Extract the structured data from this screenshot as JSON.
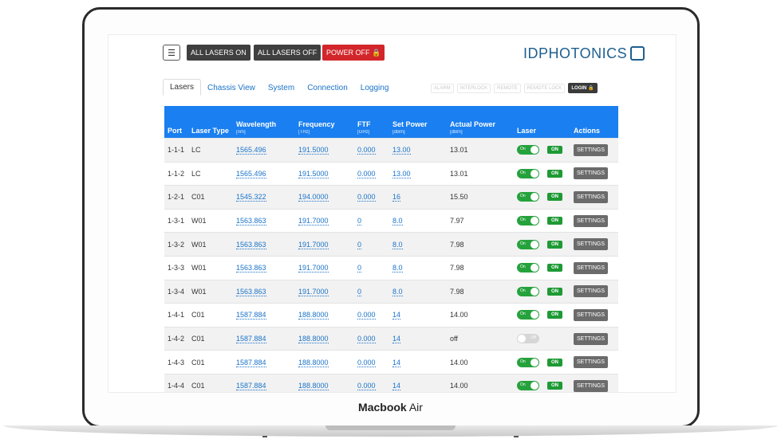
{
  "toolbar": {
    "menu_icon": "hamburger-icon",
    "all_lasers_on": "ALL LASERS ON",
    "all_lasers_off": "ALL LASERS OFF",
    "power_off": "POWER OFF",
    "power_off_icon": "lock-icon"
  },
  "brand": {
    "logo_text": "IDPHOTONICS"
  },
  "tabs": [
    {
      "label": "Lasers",
      "active": true
    },
    {
      "label": "Chassis View"
    },
    {
      "label": "System"
    },
    {
      "label": "Connection"
    },
    {
      "label": "Logging"
    }
  ],
  "status_pills": [
    "ALARM",
    "INTERLOCK",
    "REMOTE",
    "REMOTE LOCK"
  ],
  "login_label": "LOGIN",
  "table": {
    "headers": {
      "port": "Port",
      "laser_type": "Laser Type",
      "wavelength": "Wavelength",
      "wavelength_unit": "[nm]",
      "frequency": "Frequency",
      "frequency_unit": "[THz]",
      "ftf": "FTF",
      "ftf_unit": "[GHz]",
      "set_power": "Set Power",
      "set_power_unit": "[dBm]",
      "actual_power": "Actual Power",
      "actual_power_unit": "[dBm]",
      "laser": "Laser",
      "actions": "Actions"
    },
    "rows": [
      {
        "port": "1-1-1",
        "type": "LC",
        "wavelength": "1565.496",
        "frequency": "191.5000",
        "ftf": "0.000",
        "set_power": "13.00",
        "actual_power": "13.01",
        "laser_on": true
      },
      {
        "port": "1-1-2",
        "type": "LC",
        "wavelength": "1565.496",
        "frequency": "191.5000",
        "ftf": "0.000",
        "set_power": "13.00",
        "actual_power": "13.01",
        "laser_on": true
      },
      {
        "port": "1-2-1",
        "type": "C01",
        "wavelength": "1545.322",
        "frequency": "194.0000",
        "ftf": "0.000",
        "set_power": "16",
        "actual_power": "15.50",
        "laser_on": true
      },
      {
        "port": "1-3-1",
        "type": "W01",
        "wavelength": "1563.863",
        "frequency": "191.7000",
        "ftf": "0",
        "set_power": "8.0",
        "actual_power": "7.97",
        "laser_on": true
      },
      {
        "port": "1-3-2",
        "type": "W01",
        "wavelength": "1563.863",
        "frequency": "191.7000",
        "ftf": "0",
        "set_power": "8.0",
        "actual_power": "7.98",
        "laser_on": true
      },
      {
        "port": "1-3-3",
        "type": "W01",
        "wavelength": "1563.863",
        "frequency": "191.7000",
        "ftf": "0",
        "set_power": "8.0",
        "actual_power": "7.98",
        "laser_on": true
      },
      {
        "port": "1-3-4",
        "type": "W01",
        "wavelength": "1563.863",
        "frequency": "191.7000",
        "ftf": "0",
        "set_power": "8.0",
        "actual_power": "7.98",
        "laser_on": true
      },
      {
        "port": "1-4-1",
        "type": "C01",
        "wavelength": "1587.884",
        "frequency": "188.8000",
        "ftf": "0.000",
        "set_power": "14",
        "actual_power": "14.00",
        "laser_on": true
      },
      {
        "port": "1-4-2",
        "type": "C01",
        "wavelength": "1587.884",
        "frequency": "188.8000",
        "ftf": "0.000",
        "set_power": "14",
        "actual_power": "off",
        "laser_on": false
      },
      {
        "port": "1-4-3",
        "type": "C01",
        "wavelength": "1587.884",
        "frequency": "188.8000",
        "ftf": "0.000",
        "set_power": "14",
        "actual_power": "14.00",
        "laser_on": true
      },
      {
        "port": "1-4-4",
        "type": "C01",
        "wavelength": "1587.884",
        "frequency": "188.8000",
        "ftf": "0.000",
        "set_power": "14",
        "actual_power": "14.00",
        "laser_on": true
      }
    ],
    "toggle_on_label": "On",
    "toggle_off_label": "Off",
    "on_badge": "ON",
    "settings_label": "SETTINGS"
  },
  "device_label": {
    "bold": "Macbook",
    "rest": " Air"
  },
  "colors": {
    "header_blue": "#1a7ff0",
    "on_green": "#26a23c",
    "power_off_red": "#d2262b",
    "link_blue": "#1a73c9"
  }
}
